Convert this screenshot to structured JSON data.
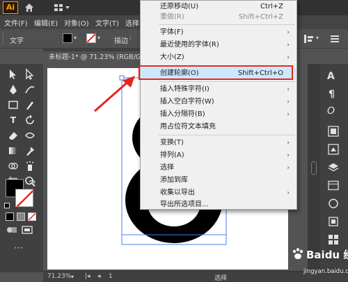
{
  "app": {
    "logo": "Ai"
  },
  "menubar": {
    "items": [
      "文件(F)",
      "编辑(E)",
      "对象(O)",
      "文字(T)",
      "选择"
    ]
  },
  "controlbar": {
    "type_label": "文字",
    "stroke_label": "描边"
  },
  "document": {
    "tab_title": "未标题-1* @ 71.23% (RGB/G"
  },
  "statusbar": {
    "zoom": "71.23%",
    "page": "1",
    "mode": "选择"
  },
  "context_menu": {
    "items": [
      {
        "label": "还原移动(U)",
        "shortcut": "Ctrl+Z",
        "disabled": false
      },
      {
        "label": "重做(R)",
        "shortcut": "Shift+Ctrl+Z",
        "disabled": true
      },
      {
        "label": "字体(F)",
        "submenu": true
      },
      {
        "label": "最近使用的字体(R)",
        "submenu": true
      },
      {
        "label": "大小(Z)",
        "submenu": true
      },
      {
        "label": "创建轮廓(O)",
        "shortcut": "Shift+Ctrl+O",
        "highlighted": true
      },
      {
        "label": "插入特殊字符(I)",
        "submenu": true
      },
      {
        "label": "插入空白字符(W)",
        "submenu": true
      },
      {
        "label": "插入分隔符(B)",
        "submenu": true
      },
      {
        "label": "用占位符文本填充"
      },
      {
        "label": "变换(T)",
        "submenu": true
      },
      {
        "label": "排列(A)",
        "submenu": true
      },
      {
        "label": "选择",
        "submenu": true
      },
      {
        "label": "添加到库"
      },
      {
        "label": "收集以导出",
        "submenu": true
      },
      {
        "label": "导出所选项目..."
      }
    ]
  },
  "watermark": {
    "brand": "Baidu 经验",
    "url": "jingyan.baidu.com"
  },
  "colors": {
    "accent_red": "#e52520",
    "highlight": "#cce8ff",
    "ui_dark": "#535353",
    "logo_orange": "#ff9a00"
  }
}
